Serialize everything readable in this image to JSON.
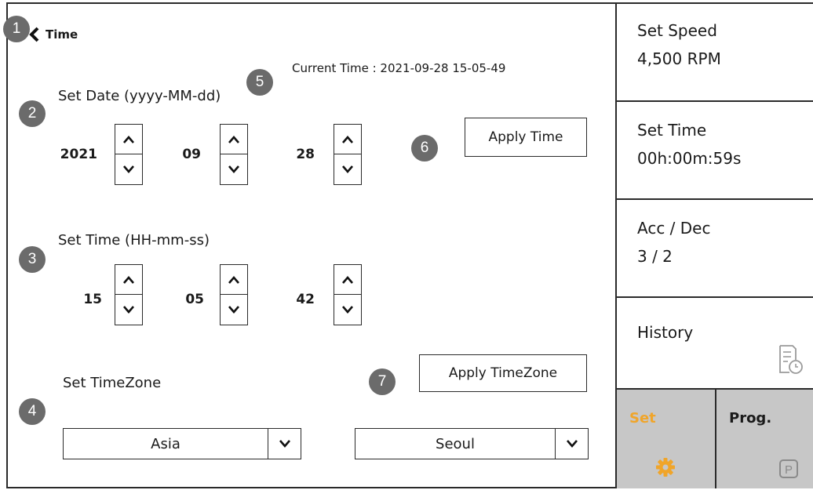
{
  "header": {
    "title": "Time"
  },
  "current_time": "Current Time : 2021-09-28 15-05-49",
  "date_section": {
    "label": "Set Date (yyyy-MM-dd)",
    "year": "2021",
    "month": "09",
    "day": "28"
  },
  "time_section": {
    "label": "Set Time (HH-mm-ss)",
    "hour": "15",
    "minute": "05",
    "second": "42"
  },
  "timezone_section": {
    "label": "Set TimeZone",
    "region": "Asia",
    "city": "Seoul"
  },
  "buttons": {
    "apply_time": "Apply Time",
    "apply_timezone": "Apply TimeZone"
  },
  "badges": [
    "1",
    "2",
    "3",
    "4",
    "5",
    "6",
    "7"
  ],
  "sidebar": {
    "speed": {
      "label": "Set Speed",
      "value": "4,500 RPM"
    },
    "time": {
      "label": "Set Time",
      "value": "00h:00m:59s"
    },
    "accdec": {
      "label": "Acc / Dec",
      "value": "3 / 2"
    },
    "history": {
      "label": "History",
      "icon": "history-icon"
    },
    "tabs": [
      {
        "label": "Set",
        "icon": "gear-icon",
        "active": true
      },
      {
        "label": "Prog.",
        "icon": "program-p-icon",
        "active": false
      }
    ]
  },
  "colors": {
    "accent": "#f0a52a",
    "tab_bg": "#c7c7c7",
    "badge": "#6b6b6b",
    "border": "#2a2a2a"
  }
}
